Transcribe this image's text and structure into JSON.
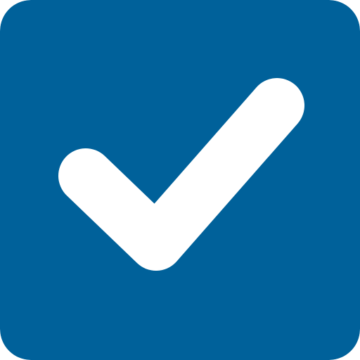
{
  "icon": {
    "name": "checkmark-icon",
    "background_color": "#00619A",
    "check_color": "#FFFFFF"
  }
}
